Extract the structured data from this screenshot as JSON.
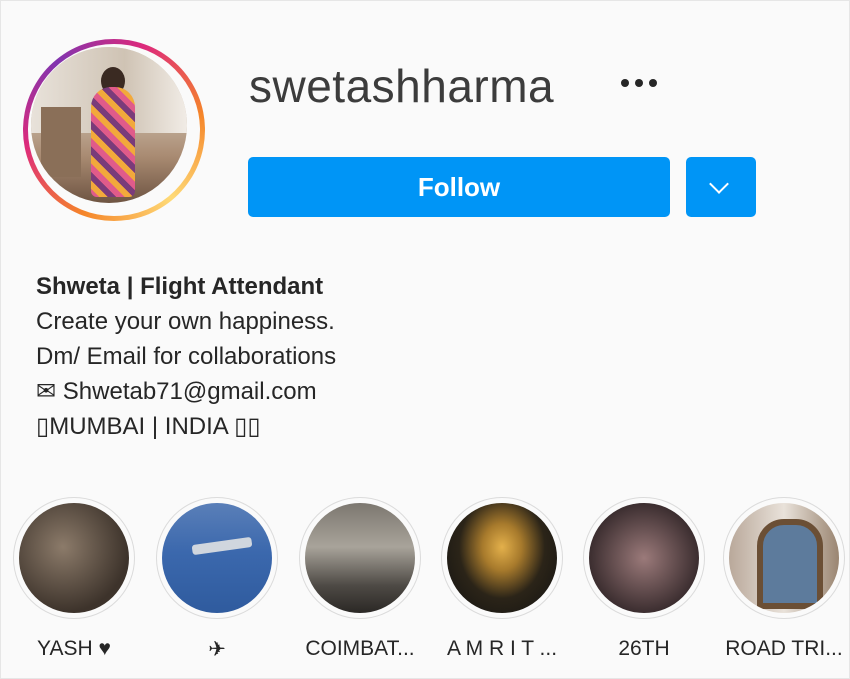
{
  "profile": {
    "username": "swetashharma",
    "more_label": "•••",
    "follow_label": "Follow"
  },
  "bio": {
    "name": "Shweta | Flight Attendant",
    "line1": "Create your own happiness.",
    "line2": "Dm/ Email for collaborations",
    "line3": "✉ Shwetab71@gmail.com",
    "line4": "▯MUMBAI | INDIA ▯▯"
  },
  "stories": [
    {
      "label": "YASH ♥"
    },
    {
      "label": "✈"
    },
    {
      "label": "COIMBAT..."
    },
    {
      "label": "A M R I T ..."
    },
    {
      "label": "26TH"
    },
    {
      "label": "ROAD TRI..."
    }
  ],
  "colors": {
    "accent": "#0095f6",
    "text": "#262626",
    "background": "#fafafa"
  }
}
